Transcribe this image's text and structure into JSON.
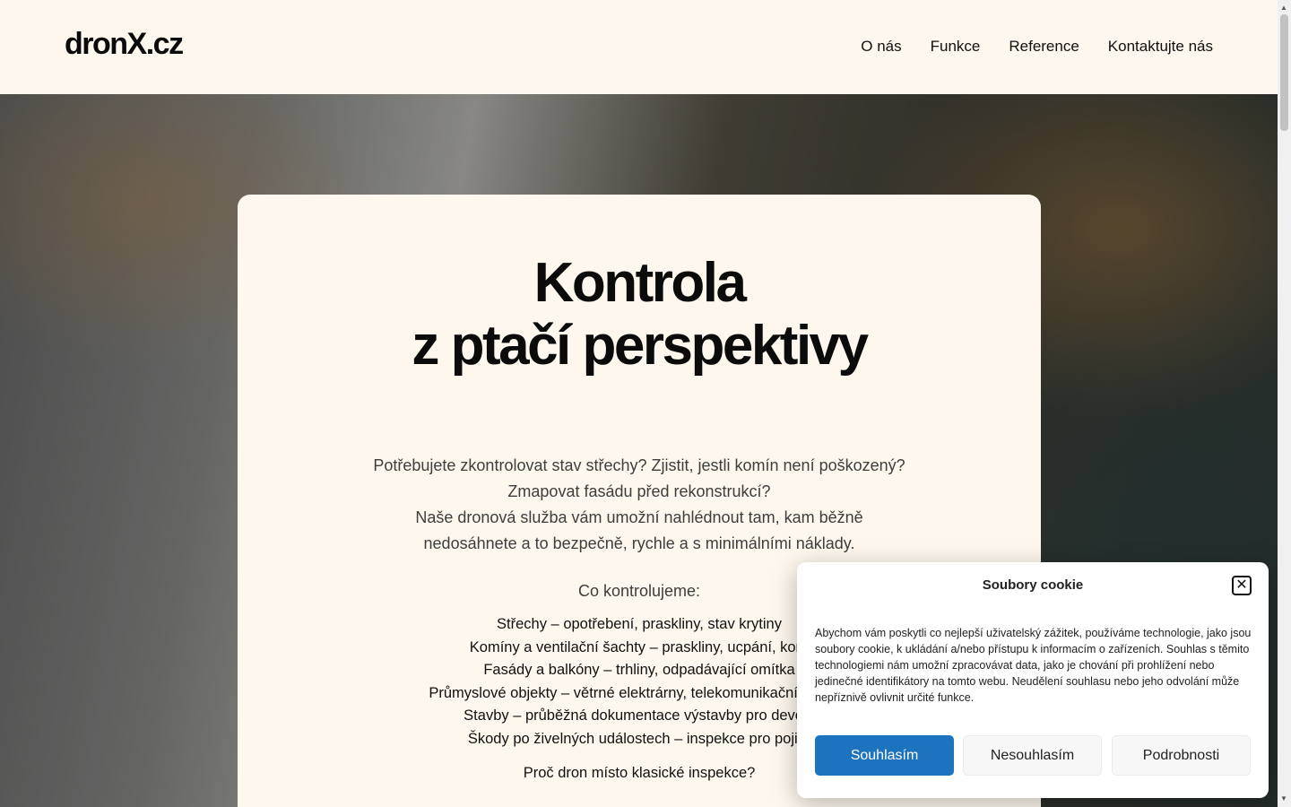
{
  "header": {
    "logo": "dronX.cz",
    "nav": [
      "O nás",
      "Funkce",
      "Reference",
      "Kontaktujte nás"
    ]
  },
  "hero": {
    "title_lines": [
      "Kontrola",
      "z ptačí perspektivy"
    ],
    "intro_lines": [
      "Potřebujete zkontrolovat stav střechy? Zjistit, jestli komín není poškozený?",
      "Zmapovat fasádu před rekonstrukcí?",
      "Naše dronová služba vám umožní nahlédnout tam, kam běžně",
      "nedosáhnete a to bezpečně, rychle a s minimálními náklady."
    ],
    "checks_title": "Co kontrolujeme:",
    "checks": [
      "Střechy – opotřebení, praskliny, stav krytiny",
      "Komíny a ventilační šachty – praskliny, ucpání, koro",
      "Fasády a balkóny – trhliny, odpadávající omítka",
      "Průmyslové objekty – větrné elektrárny, telekomunikační stožáry",
      "Stavby – průběžná dokumentace výstavby pro develo",
      "Škody po živelných událostech – inspekce pro pojišť"
    ],
    "why": "Proč dron místo klasické inspekce?"
  },
  "cookie": {
    "title": "Soubory cookie",
    "close_icon": "close-icon",
    "text": "Abychom vám poskytli co nejlepší uživatelský zážitek, používáme technologie, jako jsou soubory cookie, k ukládání a/nebo přístupu k informacím o zařízeních. Souhlas s těmito technologiemi nám umožní zpracovávat data, jako je chování při prohlížení nebo jedinečné identifikátory na tomto webu. Neudělení souhlasu nebo jeho odvolání může nepříznivě ovlivnit určité funkce.",
    "accept": "Souhlasím",
    "deny": "Nesouhlasím",
    "details": "Podrobnosti",
    "accent": "#1e73be"
  }
}
